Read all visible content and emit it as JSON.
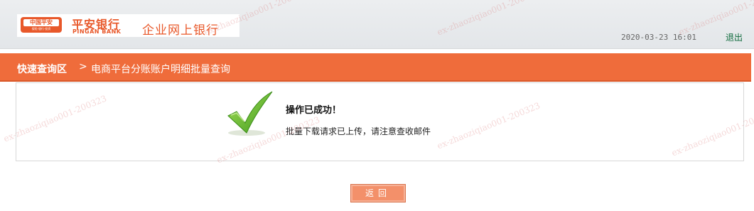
{
  "header": {
    "logo_badge_text": "中国平安",
    "logo_badge_subtext": "保险·银行·投资",
    "bank_name_cn": "平安银行",
    "bank_name_en": "PINGAN BANK",
    "product_name": "企业网上银行",
    "datetime": "2020-03-23  16:01",
    "logout_label": "退出"
  },
  "navbar": {
    "section_title": "快速查询区",
    "separator": ">",
    "page_title": "电商平台分账账户明细批量查询"
  },
  "result": {
    "icon": "checkmark-icon",
    "title": "操作已成功！",
    "message": "批量下载请求已上传，请注意查收邮件"
  },
  "actions": {
    "back_label": "返回"
  },
  "watermark": {
    "text_a": "ex-zhaoziqiao001-200323",
    "text_b": "ex-zhaoziqiao001-200323"
  },
  "colors": {
    "brand_orange": "#ef6c3b",
    "success_green": "#5cb82a"
  }
}
